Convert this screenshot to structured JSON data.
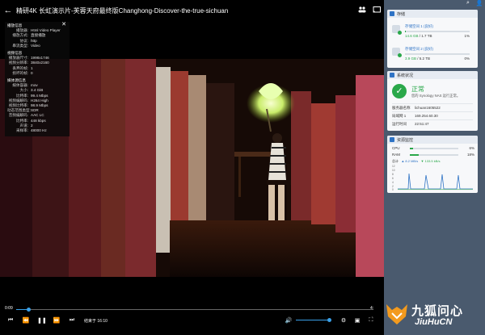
{
  "player": {
    "back_icon": "arrow-left-icon",
    "title": "精研4K 长虹演示片-芙蓉天府最终版Changhong-Discover-the-true-sichuan",
    "cast_icon": "cast-icon",
    "people_icon": "people-icon",
    "info_panel": {
      "close_icon": "close-icon",
      "sections": [
        {
          "title": "播放信息",
          "rows": [
            {
              "k": "播放器:",
              "v": "Html Video Player"
            },
            {
              "k": "播放方式:",
              "v": "直接播放"
            },
            {
              "k": "协议:",
              "v": "http"
            },
            {
              "k": "串流类型:",
              "v": "Video"
            }
          ]
        },
        {
          "title": "视频信息",
          "rows": [
            {
              "k": "播放器尺寸:",
              "v": "1998x1746"
            },
            {
              "k": "视频分辨率:",
              "v": "3840x2160"
            },
            {
              "k": "丢弃的帧:",
              "v": "1"
            },
            {
              "k": "损坏的帧:",
              "v": "0"
            }
          ]
        },
        {
          "title": "媒体源信息",
          "rows": [
            {
              "k": "媒体容器:",
              "v": "mov"
            },
            {
              "k": "大小:",
              "v": "3.4 GiB"
            },
            {
              "k": "比特率:",
              "v": "99.4 Mbps"
            },
            {
              "k": "视频编解码:",
              "v": "H264 High"
            },
            {
              "k": "视频比特率:",
              "v": "98.9 Mbps"
            },
            {
              "k": "动态范围类型:",
              "v": "SDR"
            },
            {
              "k": "音频编解码:",
              "v": "AAC LC"
            },
            {
              "k": "比特率:",
              "v": "448 kbps"
            },
            {
              "k": "声道:",
              "v": "2"
            },
            {
              "k": "采样率:",
              "v": "48000 Hz"
            }
          ]
        }
      ]
    },
    "controls": {
      "current_time": "0:09",
      "end_time_label": "结束于 16:10",
      "end_time_cut": "4:",
      "progress_fraction": 0.035,
      "volume_fraction": 0.95,
      "buttons": [
        "skip-previous-icon",
        "rewind-icon",
        "pause-icon",
        "fast-forward-icon",
        "skip-next-icon"
      ],
      "right_buttons": [
        "volume-icon",
        "settings-icon",
        "picture-in-picture-icon",
        "fullscreen-icon"
      ]
    }
  },
  "dsm": {
    "top_icons": [
      "search-icon",
      "user-icon"
    ],
    "storage": {
      "title": "存储",
      "volumes": [
        {
          "name": "存储空间 1 (良好)",
          "used": "14.6 GB",
          "total": " / 1.7 TB",
          "pct": "1%",
          "fraction": 0.01
        },
        {
          "name": "存储空间 2 (良好)",
          "used": "3.9 GB",
          "total": " / 5.2 TB",
          "pct": "0%",
          "fraction": 0.0
        }
      ]
    },
    "system": {
      "title": "系统状况",
      "status": "正常",
      "desc": "您的 Synology NAS 运行正常。",
      "rows": [
        {
          "k": "服务器名称",
          "v": "lichuan1605522"
        },
        {
          "k": "局域网 1",
          "v": "169.254.60.30"
        },
        {
          "k": "运行时间",
          "v": "22:51:47"
        }
      ]
    },
    "resource": {
      "title": "资源监控",
      "cpu_label": "CPU",
      "cpu_pct": "6%",
      "cpu_fraction": 0.06,
      "ram_label": "RAM",
      "ram_pct": "18%",
      "ram_fraction": 0.18,
      "net_label": "总计",
      "net_up": "▲ 8.2 MB/s",
      "net_down": "▼ 133.5 kB/s",
      "y_ticks": [
        "12",
        "10",
        "8",
        "6",
        "4",
        "2",
        "0"
      ]
    }
  },
  "watermark": {
    "cn": "九狐问心",
    "en": "JiuHuCN"
  }
}
